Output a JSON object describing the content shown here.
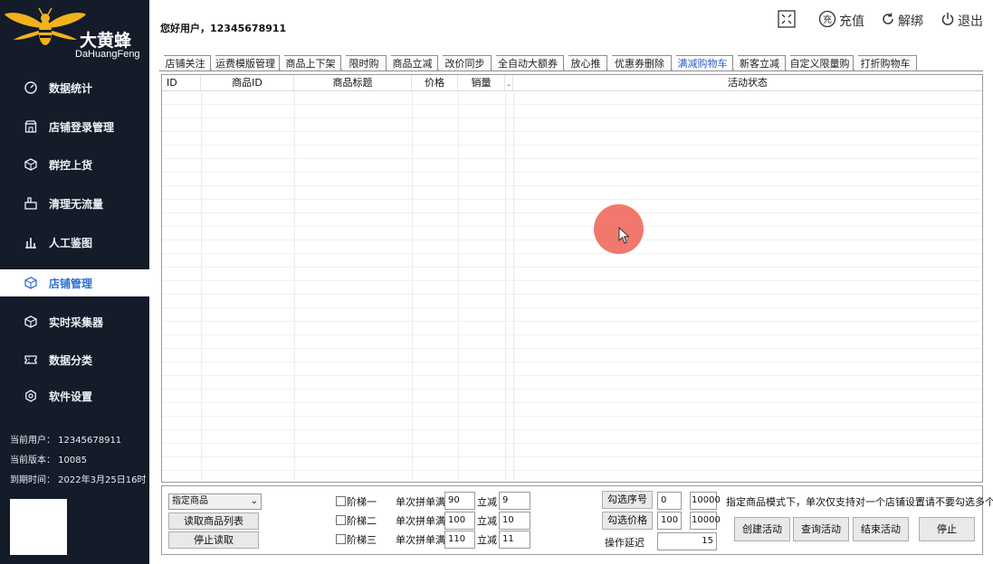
{
  "app": {
    "logo_cn": "大黄蜂",
    "logo_en": "DaHuangFeng",
    "accent": "#2f6fd0",
    "sidebar_bg": "#141b29"
  },
  "header": {
    "greeting": "您好用户，12345678911",
    "actions": [
      {
        "label": "",
        "icon": "fullscreen-icon"
      },
      {
        "label": "充值",
        "icon": "recharge-icon"
      },
      {
        "label": "解绑",
        "icon": "refresh-icon"
      },
      {
        "label": "退出",
        "icon": "power-icon"
      }
    ]
  },
  "sidebar": {
    "items": [
      {
        "label": "数据统计",
        "icon": "dashboard-icon"
      },
      {
        "label": "店铺登录管理",
        "icon": "store-icon"
      },
      {
        "label": "群控上货",
        "icon": "box-icon"
      },
      {
        "label": "清理无流量",
        "icon": "cleanup-icon"
      },
      {
        "label": "人工鉴图",
        "icon": "chart-icon"
      },
      {
        "label": "店铺管理",
        "icon": "shop-icon",
        "active": true
      },
      {
        "label": "实时采集器",
        "icon": "collector-icon"
      },
      {
        "label": "数据分类",
        "icon": "ticket-icon"
      },
      {
        "label": "软件设置",
        "icon": "settings-icon"
      }
    ],
    "info": {
      "user": "当前用户： 12345678911",
      "version": "当前版本： 10085",
      "expire": "到期时间： 2022年3月25日16时"
    }
  },
  "tabs": [
    {
      "label": "店铺关注"
    },
    {
      "label": "运费模版管理"
    },
    {
      "label": "商品上下架"
    },
    {
      "label": "限时购"
    },
    {
      "label": "商品立减"
    },
    {
      "label": "改价同步"
    },
    {
      "label": "全自动大额券"
    },
    {
      "label": "放心推"
    },
    {
      "label": "优惠券删除"
    },
    {
      "label": "满减购物车",
      "active": true
    },
    {
      "label": "新客立减"
    },
    {
      "label": "自定义限量购"
    },
    {
      "label": "打折购物车"
    }
  ],
  "grid": {
    "columns": [
      "ID",
      "商品ID",
      "商品标题",
      "价格",
      "销量",
      ".",
      "活动状态"
    ],
    "rows": []
  },
  "panel": {
    "mode_select": "指定商品",
    "read_list_btn": "读取商品列表",
    "stop_read_btn": "停止读取",
    "tiers": [
      {
        "label": "阶梯一",
        "threshold_label": "单次拼单满",
        "threshold": "90",
        "discount_label": "立减",
        "discount": "9"
      },
      {
        "label": "阶梯二",
        "threshold_label": "单次拼单满",
        "threshold": "100",
        "discount_label": "立减",
        "discount": "10"
      },
      {
        "label": "阶梯三",
        "threshold_label": "单次拼单满",
        "threshold": "110",
        "discount_label": "立减",
        "discount": "11"
      }
    ],
    "select_index_btn": "勾选序号",
    "index_from": "0",
    "index_to": "10000",
    "select_price_btn": "勾选价格",
    "price_from": "100",
    "price_to": "10000",
    "delay_label": "操作延迟",
    "delay_value": "15",
    "note": "指定商品模式下，单次仅支持对一个店铺设置请不要勾选多个",
    "create_btn": "创建活动",
    "query_btn": "查询活动",
    "end_btn": "结束活动",
    "stop_btn": "停止"
  }
}
